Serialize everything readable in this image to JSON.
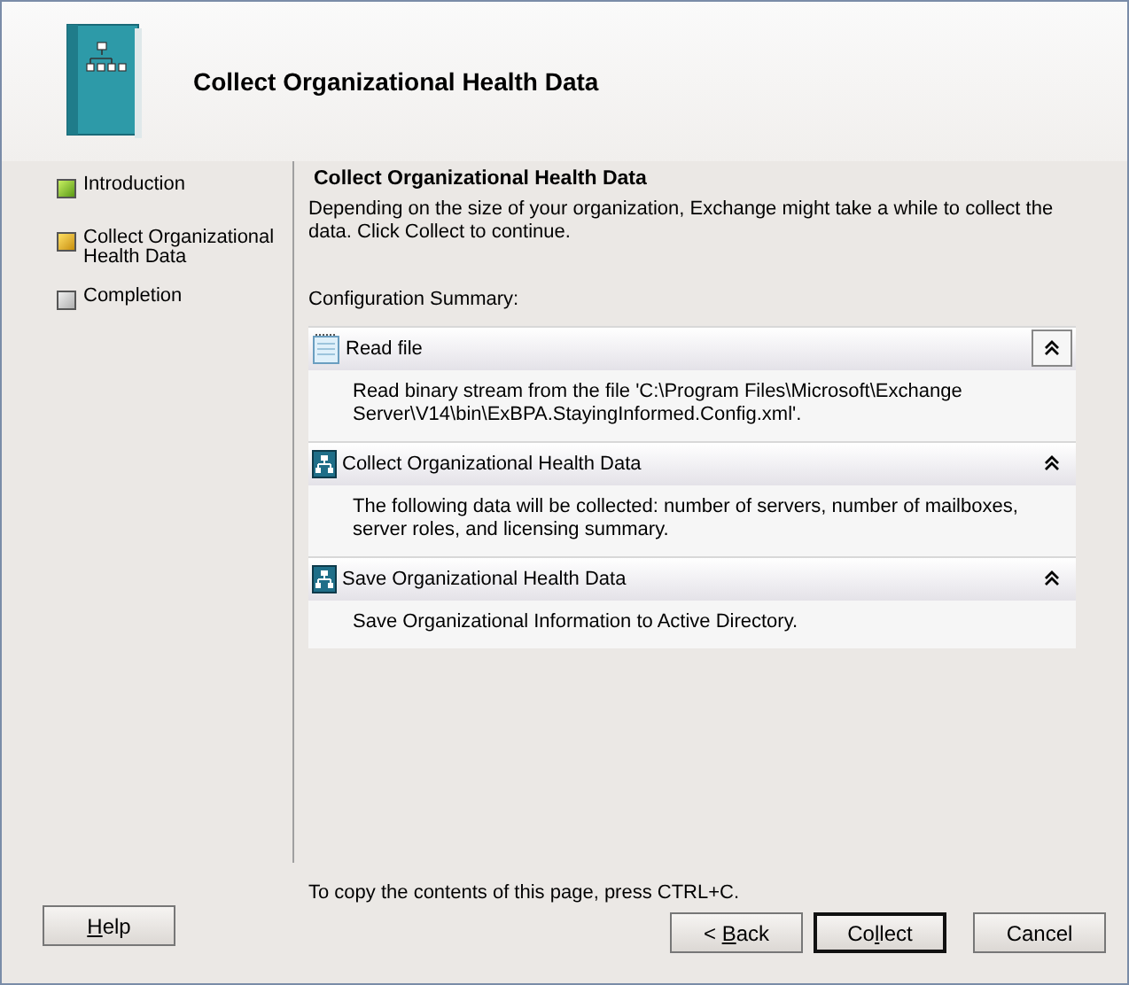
{
  "header": {
    "title": "Collect Organizational Health Data"
  },
  "steps": [
    {
      "label": "Introduction",
      "kind": "done"
    },
    {
      "label": "Collect Organizational Health Data",
      "kind": "current"
    },
    {
      "label": "Completion",
      "kind": "pending"
    }
  ],
  "page": {
    "heading": "Collect Organizational Health Data",
    "intro": "Depending on the size of your organization, Exchange might take a while to collect the data. Click Collect to continue.",
    "summary_label": "Configuration Summary:"
  },
  "sections": [
    {
      "title": "Read file",
      "kind": "file",
      "expanded": true,
      "focused": true,
      "body": "Read binary stream from the file 'C:\\Program Files\\Microsoft\\Exchange Server\\V14\\bin\\ExBPA.StayingInformed.Config.xml'."
    },
    {
      "title": "Collect Organizational Health Data",
      "kind": "org",
      "expanded": true,
      "focused": false,
      "body": "The following data will be collected: number of servers, number of mailboxes, server roles, and  licensing summary."
    },
    {
      "title": "Save Organizational Health Data",
      "kind": "org",
      "expanded": true,
      "focused": false,
      "body": "Save Organizational Information to Active Directory."
    }
  ],
  "copy_hint": "To copy the contents of this page, press CTRL+C.",
  "buttons": {
    "help": {
      "key": "H",
      "after": "elp"
    },
    "back": {
      "before": "< ",
      "key": "B",
      "after": "ack"
    },
    "next": {
      "before": "Co",
      "key": "l",
      "after": "lect",
      "default": true
    },
    "cancel": {
      "before": "Cancel"
    }
  }
}
